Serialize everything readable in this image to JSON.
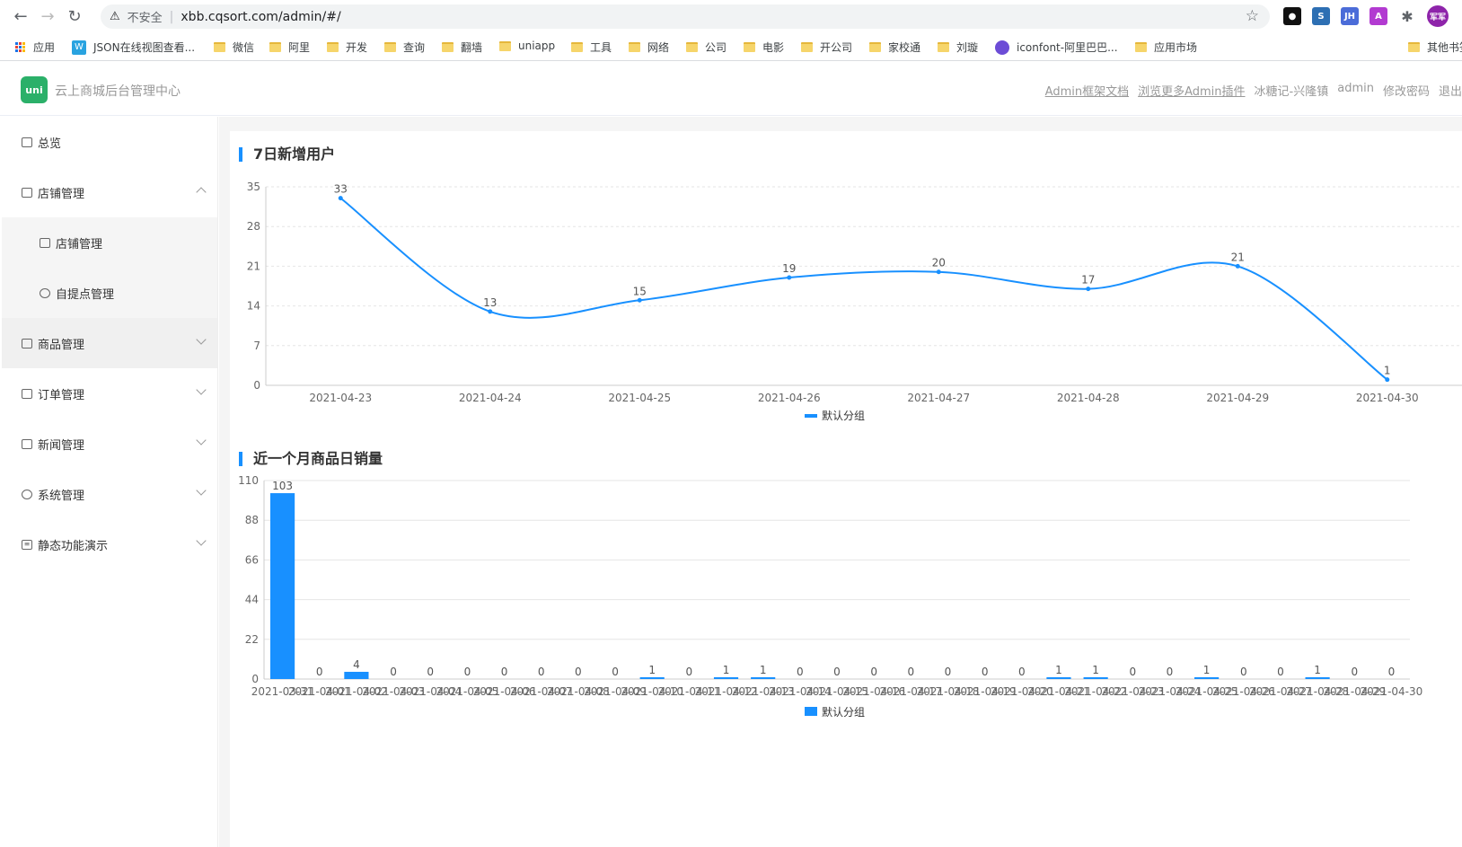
{
  "browser": {
    "insecure_label": "不安全",
    "url": "xbb.cqsort.com/admin/#/",
    "bookmarks": [
      "应用",
      "JSON在线视图查看...",
      "微信",
      "阿里",
      "开发",
      "查询",
      "翻墙",
      "uniapp",
      "工具",
      "网络",
      "公司",
      "电影",
      "开公司",
      "家校通",
      "刘璇",
      "iconfont-阿里巴巴...",
      "应用市场",
      "其他书签"
    ],
    "avatar_text": "军军"
  },
  "header": {
    "logo_text": "uni",
    "title": "云上商城后台管理中心",
    "links": [
      "Admin框架文档",
      "浏览更多Admin插件",
      "冰糖记-兴隆镇",
      "admin",
      "修改密码",
      "退出"
    ]
  },
  "sidebar": {
    "items": [
      {
        "label": "总览"
      },
      {
        "label": "店铺管理"
      },
      {
        "label": "店铺管理"
      },
      {
        "label": "自提点管理"
      },
      {
        "label": "商品管理"
      },
      {
        "label": "订单管理"
      },
      {
        "label": "新闻管理"
      },
      {
        "label": "系统管理"
      },
      {
        "label": "静态功能演示"
      }
    ]
  },
  "colors": {
    "accent": "#1890ff",
    "logo": "#2bb069"
  },
  "chart_data": [
    {
      "type": "line",
      "title": "7日新增用户",
      "categories": [
        "2021-04-23",
        "2021-04-24",
        "2021-04-25",
        "2021-04-26",
        "2021-04-27",
        "2021-04-28",
        "2021-04-29",
        "2021-04-30"
      ],
      "series": [
        {
          "name": "默认分组",
          "values": [
            33,
            13,
            15,
            19,
            20,
            17,
            21,
            1
          ]
        }
      ],
      "yticks": [
        0,
        7,
        14,
        21,
        28,
        35
      ],
      "ylim": [
        0,
        35
      ],
      "legend": "bottom-center",
      "grid": true
    },
    {
      "type": "bar",
      "title": "近一个月商品日销量",
      "categories": [
        "2021-03-31",
        "2021-04-01",
        "2021-04-02",
        "2021-04-03",
        "2021-04-04",
        "2021-04-05",
        "2021-04-06",
        "2021-04-07",
        "2021-04-08",
        "2021-04-09",
        "2021-04-10",
        "2021-04-11",
        "2021-04-12",
        "2021-04-13",
        "2021-04-14",
        "2021-04-15",
        "2021-04-16",
        "2021-04-17",
        "2021-04-18",
        "2021-04-19",
        "2021-04-20",
        "2021-04-21",
        "2021-04-22",
        "2021-04-23",
        "2021-04-24",
        "2021-04-25",
        "2021-04-26",
        "2021-04-27",
        "2021-04-28",
        "2021-04-29",
        "2021-04-30"
      ],
      "series": [
        {
          "name": "默认分组",
          "values": [
            103,
            0,
            4,
            0,
            0,
            0,
            0,
            0,
            0,
            0,
            1,
            0,
            1,
            1,
            0,
            0,
            0,
            0,
            0,
            0,
            0,
            1,
            1,
            0,
            0,
            1,
            0,
            0,
            1,
            0,
            0
          ]
        }
      ],
      "yticks": [
        0,
        22,
        44,
        66,
        88,
        110
      ],
      "ylim": [
        0,
        110
      ],
      "legend": "bottom-center",
      "grid": true
    }
  ]
}
